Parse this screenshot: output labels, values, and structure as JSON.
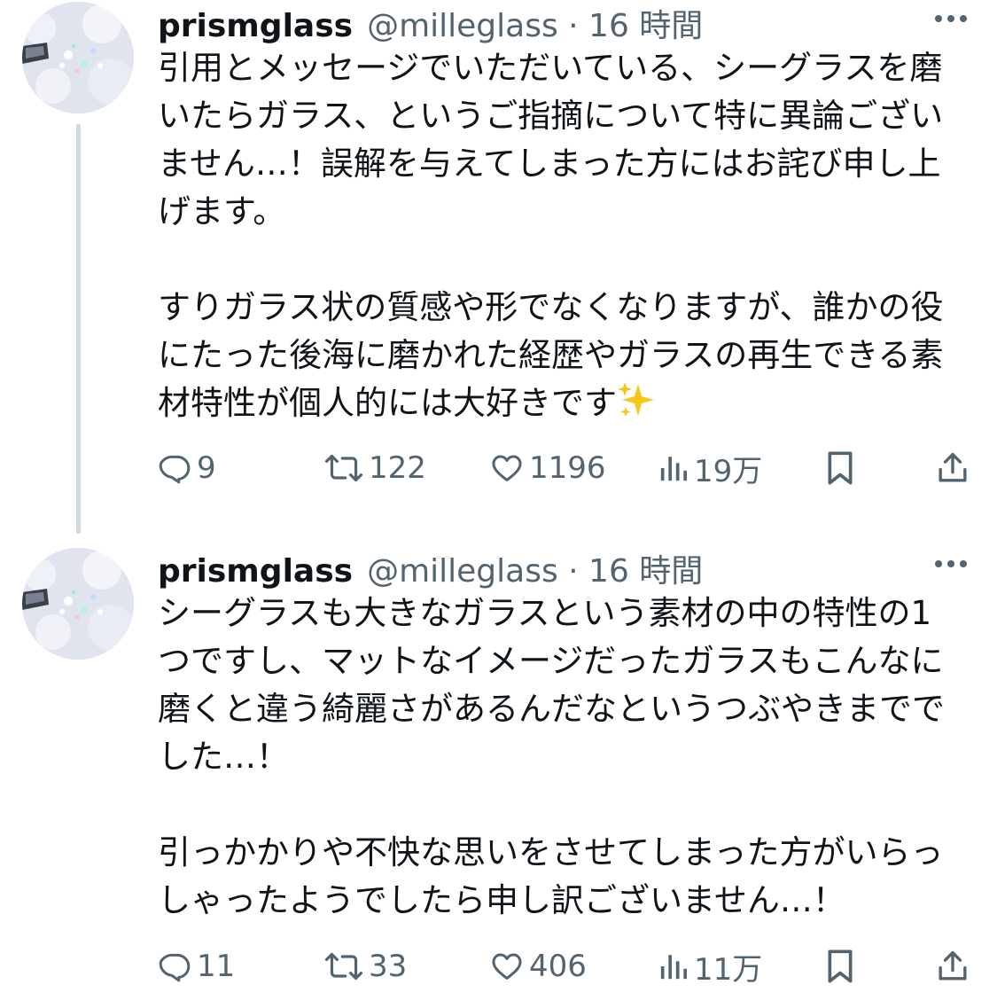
{
  "colors": {
    "text": "#0f1419",
    "secondary": "#536471",
    "thread_line": "#cfd9de",
    "sparkle": "#f5c518"
  },
  "tweets": [
    {
      "display_name": "prismglass",
      "meta": "@milleglass · 16 時間",
      "body": "引用とメッセージでいただいている、シーグラスを磨いたらガラス、というご指摘について特に異論ございません…！誤解を与えてしまった方にはお詫び申し上げます。\n\nすりガラス状の質感や形でなくなりますが、誰かの役にたった後海に磨かれた経歴やガラスの再生できる素材特性が個人的には大好きです",
      "emoji": "sparkles-icon",
      "actions": {
        "replies": "9",
        "reposts": "122",
        "likes": "1196",
        "views": "19万"
      }
    },
    {
      "display_name": "prismglass",
      "meta": "@milleglass · 16 時間",
      "body": "シーグラスも大きなガラスという素材の中の特性の1つですし、マットなイメージだったガラスもこんなに磨くと違う綺麗さがあるんだなというつぶやきまででした…！\n\n引っかかりや不快な思いをさせてしまった方がいらっしゃったようでしたら申し訳ございません…！",
      "actions": {
        "replies": "11",
        "reposts": "33",
        "likes": "406",
        "views": "11万"
      }
    }
  ]
}
